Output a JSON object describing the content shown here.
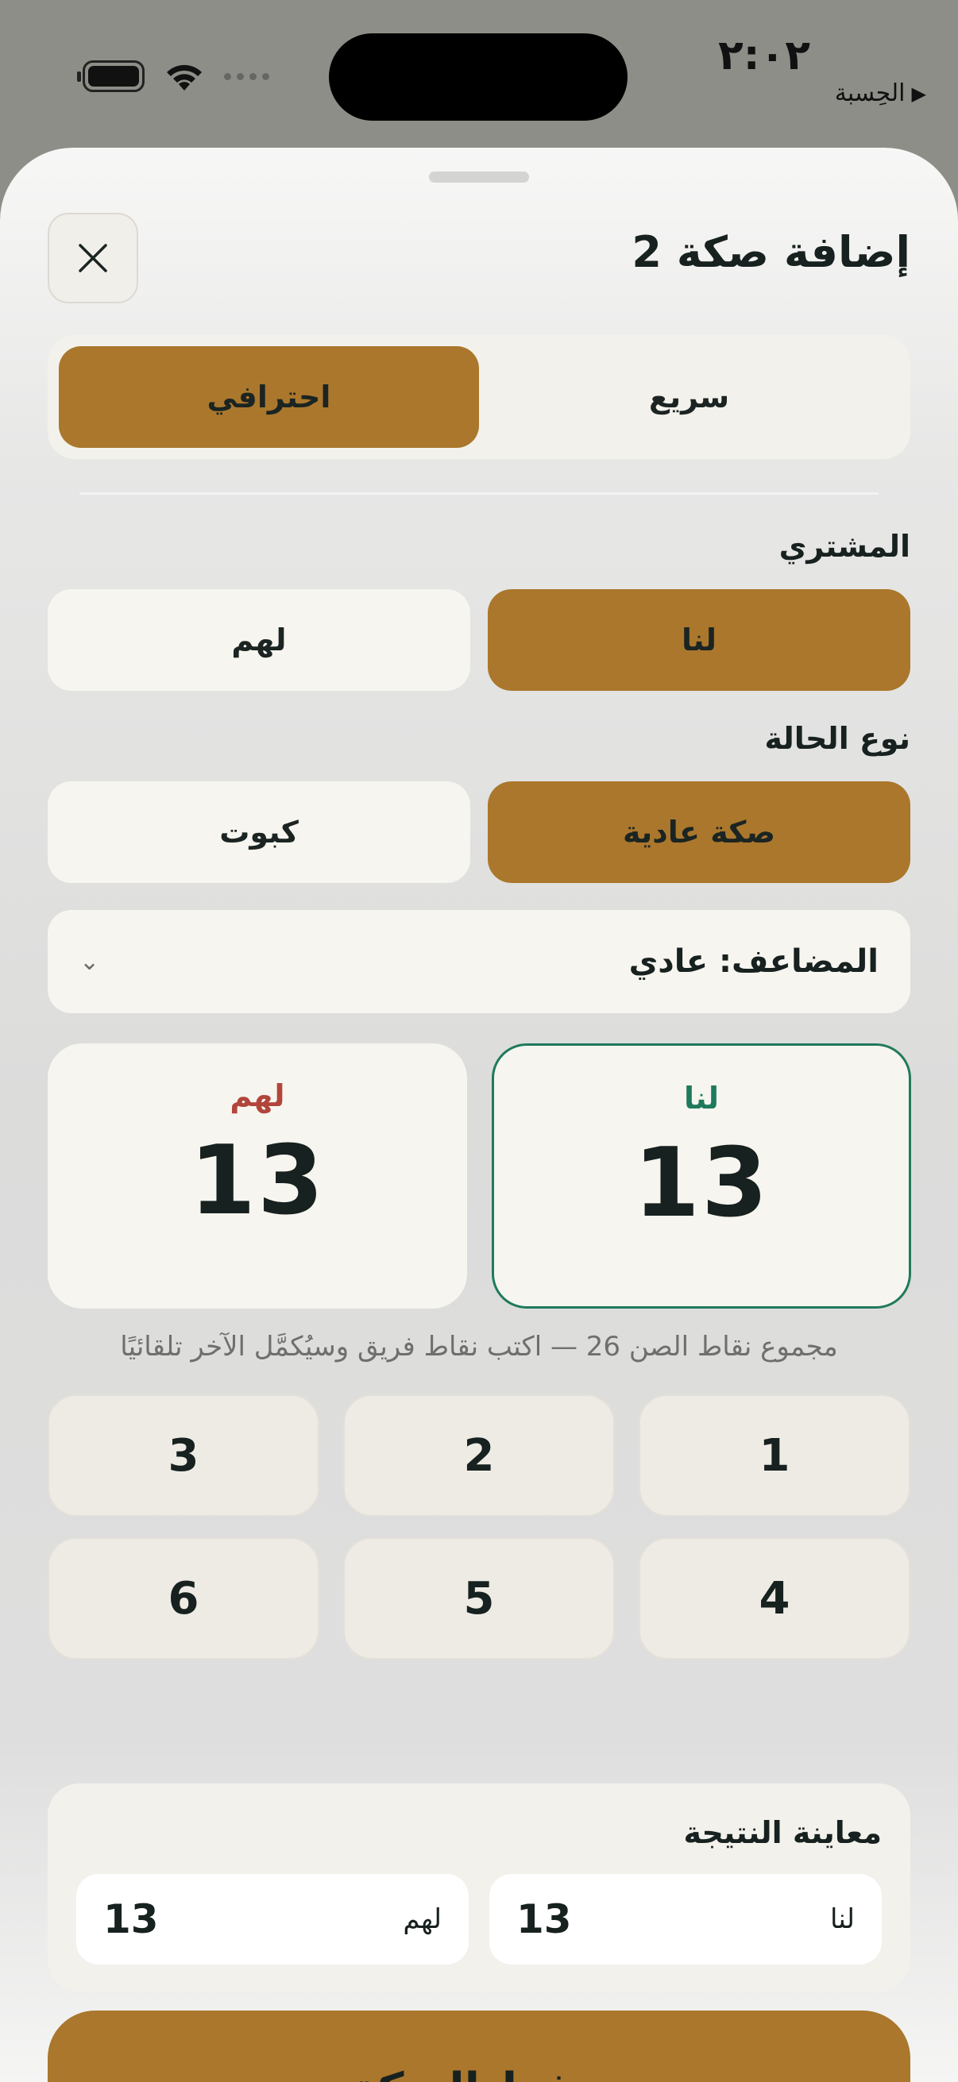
{
  "status_bar": {
    "time": "٢:٠٢",
    "back_app": "الحِسبة"
  },
  "sheet": {
    "title": "إضافة صكة 2",
    "mode": {
      "quick": "سريع",
      "pro": "احترافي",
      "selected": "pro"
    },
    "buyer": {
      "label": "المشتري",
      "ours": "لنا",
      "theirs": "لهم",
      "selected": "ours"
    },
    "case_type": {
      "label": "نوع الحالة",
      "normal": "صكة عادية",
      "kaboot": "كبوت",
      "selected": "normal"
    },
    "multiplier": {
      "text": "المضاعف: عادي"
    },
    "scores": {
      "ours_label": "لنا",
      "ours_value": "13",
      "theirs_label": "لهم",
      "theirs_value": "13"
    },
    "hint": "مجموع نقاط الصن 26 — اكتب نقاط فريق وسيُكمَّل الآخر تلقائيًا",
    "keypad": [
      "1",
      "2",
      "3",
      "4",
      "5",
      "6"
    ],
    "preview": {
      "title": "معاينة النتيجة",
      "ours_label": "لنا",
      "ours_value": "13",
      "theirs_label": "لهم",
      "theirs_value": "13"
    },
    "save_label": "حفظ الصكة"
  },
  "icons": {
    "close": "close-icon",
    "dropdown": "chevron-down-icon"
  },
  "colors": {
    "accent": "#aa772c",
    "ours": "#1f7a5c",
    "theirs": "#b2453b"
  }
}
